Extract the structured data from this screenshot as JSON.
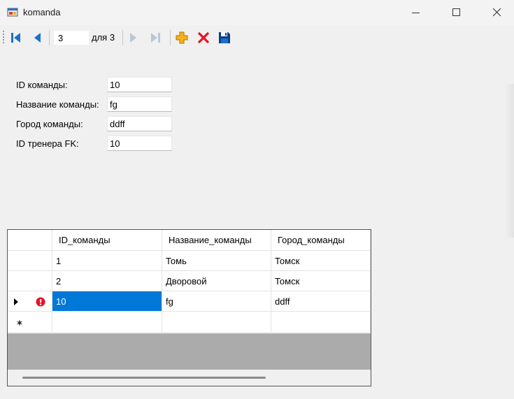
{
  "window": {
    "title": "komanda",
    "icon": "app-form-icon",
    "controls": [
      "minimize-icon",
      "maximize-icon",
      "close-icon"
    ]
  },
  "navigator": {
    "position": "3",
    "count_label": "для 3",
    "icons": [
      "move-first-icon",
      "move-previous-icon",
      "move-next-icon",
      "move-last-icon",
      "add-new-icon",
      "delete-icon",
      "save-icon"
    ]
  },
  "form": {
    "fields": [
      {
        "label": "ID команды:",
        "value": "10"
      },
      {
        "label": "Название команды:",
        "value": "fg"
      },
      {
        "label": "Город команды:",
        "value": "ddff"
      },
      {
        "label": "ID тренера FK:",
        "value": "10"
      }
    ]
  },
  "grid": {
    "columns": [
      "ID_команды",
      "Название_команды",
      "Город_команды"
    ],
    "rows": [
      [
        "1",
        "Томь",
        "Томск"
      ],
      [
        "2",
        "Дворовой",
        "Томск"
      ],
      [
        "10",
        "fg",
        "ddff"
      ]
    ],
    "current_row_index": 2,
    "error_row_index": 2
  },
  "colors": {
    "accent_blue": "#0078d7",
    "delete_red": "#e81123",
    "add_orange": "#f5b21a",
    "nav_blue": "#1e6fc9"
  }
}
